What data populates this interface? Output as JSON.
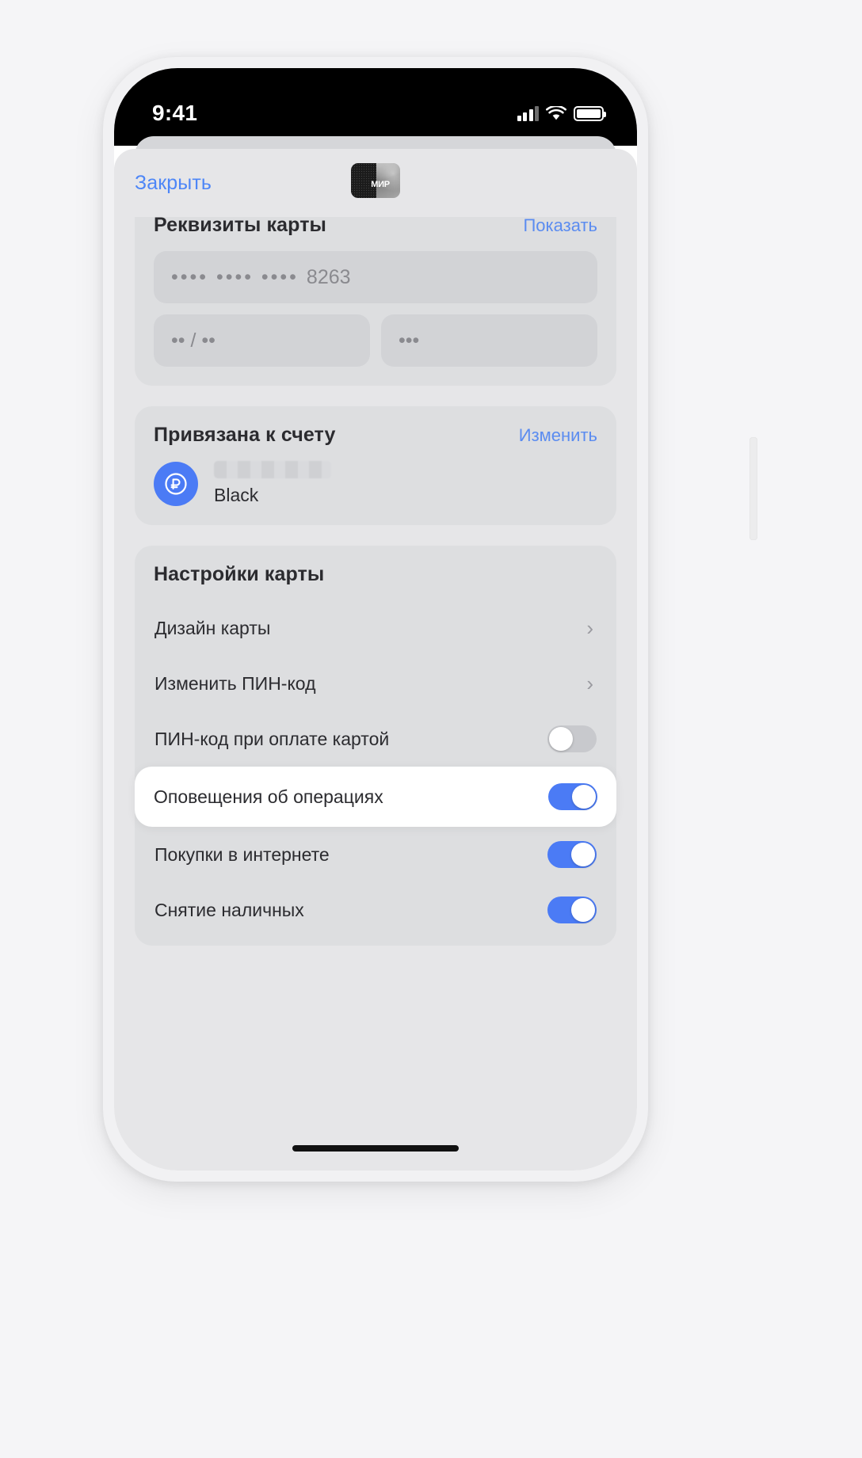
{
  "status_bar": {
    "time": "9:41",
    "signal_icon": "cellular-signal-icon",
    "wifi_icon": "wifi-icon",
    "battery_icon": "battery-full-icon"
  },
  "sheet": {
    "close_label": "Закрыть",
    "card_icon_label": "МИР",
    "card_icon_name": "mir-card-icon"
  },
  "card_details": {
    "title": "Реквизиты карты",
    "action_label": "Показать",
    "number_masked": "••••  ••••  ••••",
    "number_last4": "8263",
    "expiry_masked": "•• / ••",
    "cvv_masked": "•••"
  },
  "linked_account": {
    "title": "Привязана к счету",
    "action_label": "Изменить",
    "avatar_icon": "ruble-currency-icon",
    "account_name_redacted": "",
    "account_tier": "Black"
  },
  "card_settings": {
    "title": "Настройки карты",
    "rows": [
      {
        "label": "Дизайн карты",
        "control": "chevron",
        "chevron": "›"
      },
      {
        "label": "Изменить ПИН-код",
        "control": "chevron",
        "chevron": "›"
      },
      {
        "label": "ПИН-код при оплате картой",
        "control": "toggle",
        "value": false
      },
      {
        "label": "Оповещения об операциях",
        "control": "toggle",
        "value": true,
        "highlighted": true
      },
      {
        "label": "Покупки в интернете",
        "control": "toggle",
        "value": true
      },
      {
        "label": "Снятие наличных",
        "control": "toggle",
        "value": true
      }
    ]
  },
  "colors": {
    "accent_blue": "#4b7bf5",
    "link_blue": "#5b8cf0",
    "page_background": "#f5f5f7",
    "sheet_background": "#e6e6e8",
    "block_background": "#dddee0",
    "toggle_off": "#c8c9cd"
  }
}
